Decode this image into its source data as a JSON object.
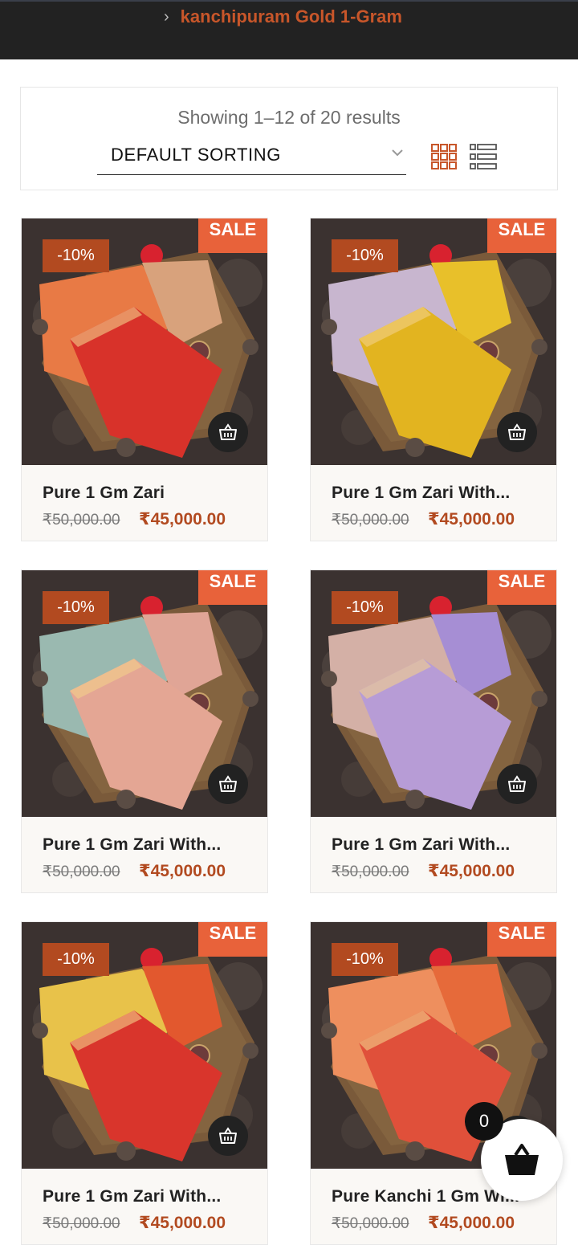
{
  "breadcrumb": {
    "separator": "›",
    "category": "kanchipuram Gold 1-Gram"
  },
  "toolbar": {
    "result_count": "Showing 1–12 of 20 results",
    "sort_label": "DEFAULT SORTING",
    "grid_view_icon": "grid-view-icon",
    "list_view_icon": "list-view-icon"
  },
  "products": [
    {
      "title": "Pure 1 Gm Zari",
      "price_old": "₹50,000.00",
      "price_new": "₹45,000.00",
      "sale": "SALE",
      "discount": "-10%",
      "colors": [
        "#e87a45",
        "#d8a27c",
        "#d8322a"
      ]
    },
    {
      "title": "Pure 1 Gm Zari With...",
      "price_old": "₹50,000.00",
      "price_new": "₹45,000.00",
      "sale": "SALE",
      "discount": "-10%",
      "colors": [
        "#c8b6cf",
        "#e8c02a",
        "#e2b420"
      ]
    },
    {
      "title": "Pure 1 Gm Zari With...",
      "price_old": "₹50,000.00",
      "price_new": "₹45,000.00",
      "sale": "SALE",
      "discount": "-10%",
      "colors": [
        "#9ab9b0",
        "#e0a596",
        "#e4a694"
      ]
    },
    {
      "title": "Pure 1 Gm Zari With...",
      "price_old": "₹50,000.00",
      "price_new": "₹45,000.00",
      "sale": "SALE",
      "discount": "-10%",
      "colors": [
        "#d4b0a6",
        "#a68ed4",
        "#b79cd6"
      ]
    },
    {
      "title": "Pure 1 Gm Zari With...",
      "price_old": "₹50,000.00",
      "price_new": "₹45,000.00",
      "sale": "SALE",
      "discount": "-10%",
      "colors": [
        "#e8c24a",
        "#e2582e",
        "#d9352c"
      ]
    },
    {
      "title": "Pure Kanchi 1 Gm Wi...",
      "price_old": "₹50,000.00",
      "price_new": "₹45,000.00",
      "sale": "SALE",
      "discount": "-10%",
      "colors": [
        "#ee8f5e",
        "#e66a3a",
        "#e0503a"
      ]
    }
  ],
  "mini_cart": {
    "count": "0",
    "icon": "basket-icon"
  },
  "colors": {
    "accent": "#b24a20",
    "sale_badge": "#e8623a",
    "header_bg": "#222222"
  }
}
